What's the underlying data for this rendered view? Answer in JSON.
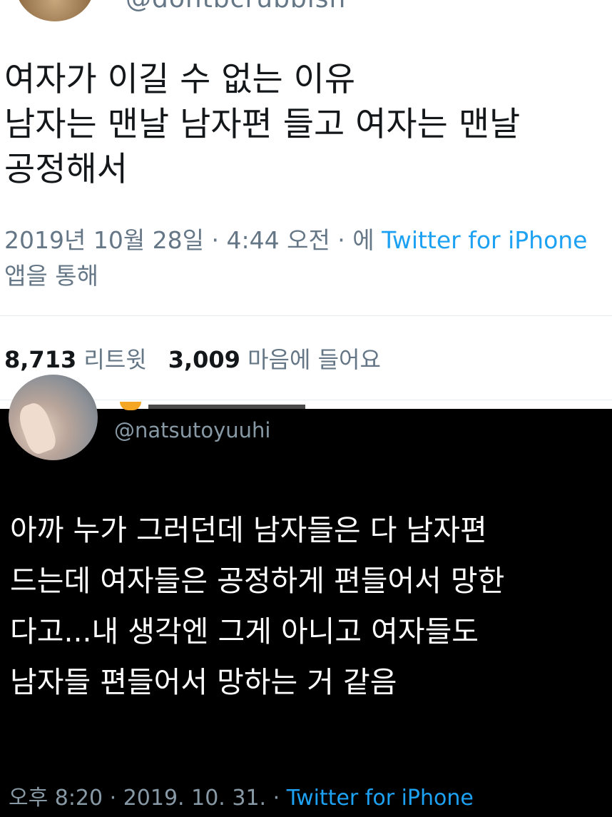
{
  "tweet1": {
    "handle": "@dontbcrubbish",
    "text_lines": [
      "여자가 이길 수 없는 이유",
      "남자는 맨날 남자편 들고 여자는 맨날",
      "공정해서"
    ],
    "date": "2019년 10월 28일 · 4:44 오전 · 에 ",
    "source": "Twitter for iPhone",
    "via": "앱을 통해",
    "retweets_count": "8,713",
    "retweets_label": "리트윗",
    "likes_count": "3,009",
    "likes_label": "마음에 들어요"
  },
  "tweet2": {
    "handle": "@natsutoyuuhi",
    "text_lines": [
      "아까 누가 그러던데 남자들은 다 남자편",
      "드는데 여자들은 공정하게 편들어서 망한",
      "다고...내 생각엔 그게 아니고 여자들도",
      "남자들 편들어서 망하는 거 같음"
    ],
    "timestamp": "오후 8:20 · 2019. 10. 31. · ",
    "source": "Twitter for iPhone"
  }
}
